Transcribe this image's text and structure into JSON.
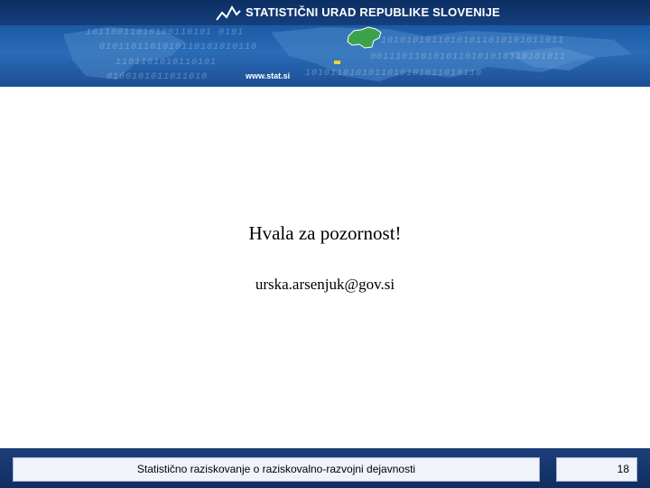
{
  "banner": {
    "title": "STATISTIČNI URAD REPUBLIKE SLOVENIJE",
    "url": "www.stat.si",
    "logo_icon": "chart-line-logo-icon",
    "map_icon": "slovenia-map-icon",
    "colors": {
      "banner": "#1c5aa4",
      "slovenia": "#3aa34a",
      "footer": "#1d3f7a"
    }
  },
  "slide": {
    "title": "Hvala za pozornost!",
    "email": "urska.arsenjuk@gov.si"
  },
  "footer": {
    "caption": "Statistično raziskovanje o raziskovalno-razvojni dejavnosti",
    "page_number": "18"
  }
}
